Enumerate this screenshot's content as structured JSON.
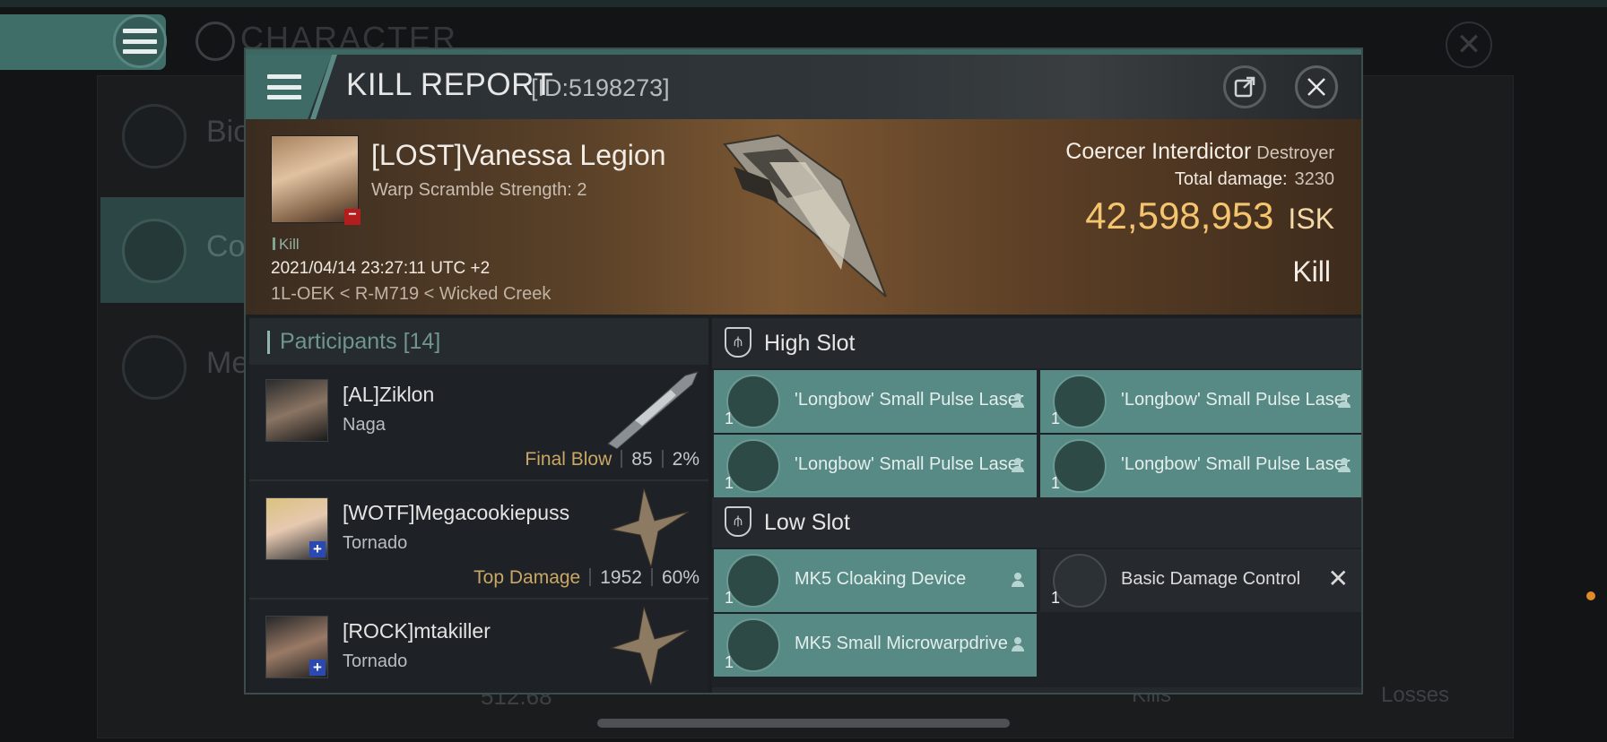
{
  "background": {
    "title": "CHARACTER",
    "side_items": [
      {
        "label": "Bio"
      },
      {
        "label": "Con"
      },
      {
        "label": "Me"
      }
    ],
    "bottom_value": "512.68",
    "kills_label": "Kills",
    "losses_label": "Losses"
  },
  "modal": {
    "title": "KILL REPORT",
    "report_id": "[ID:5198273]"
  },
  "victim": {
    "name": "[LOST]Vanessa Legion",
    "warp_scramble": "Warp Scramble Strength: 2",
    "kill_tag": "Kill",
    "timestamp": "2021/04/14 23:27:11 UTC +2",
    "location": "1L-OEK < R-M719 < Wicked Creek",
    "ship_name": "Coercer Interdictor",
    "ship_class": "Destroyer",
    "total_damage_label": "Total damage:",
    "total_damage": "3230",
    "isk_value": "42,598,953",
    "isk_unit": "ISK",
    "result": "Kill"
  },
  "participants": {
    "label": "Participants",
    "count": "[14]",
    "rows": [
      {
        "name": "[AL]Ziklon",
        "ship": "Naga",
        "role": "Final Blow",
        "damage": "85",
        "percent": "2%"
      },
      {
        "name": "[WOTF]Megacookiepuss",
        "ship": "Tornado",
        "role": "Top Damage",
        "damage": "1952",
        "percent": "60%"
      },
      {
        "name": "[ROCK]mtakiller",
        "ship": "Tornado",
        "role": "",
        "damage": "",
        "percent": ""
      }
    ]
  },
  "fitting": {
    "high_slot": {
      "title": "High Slot",
      "modules": [
        {
          "name": "'Longbow' Small Pulse Laser",
          "qty": "1"
        },
        {
          "name": "'Longbow' Small Pulse Laser",
          "qty": "1"
        },
        {
          "name": "'Longbow' Small Pulse Laser",
          "qty": "1"
        },
        {
          "name": "'Longbow' Small Pulse Laser",
          "qty": "1"
        }
      ]
    },
    "low_slot": {
      "title": "Low Slot",
      "modules": [
        {
          "name": "MK5 Cloaking Device",
          "qty": "1",
          "status": "dropped"
        },
        {
          "name": "Basic Damage Control",
          "qty": "1",
          "status": "destroyed"
        },
        {
          "name": "MK5 Small Microwarpdrive",
          "qty": "1",
          "status": "dropped"
        }
      ]
    }
  },
  "icons": {
    "menu": "hamburger-icon",
    "share": "external-link-icon",
    "close": "close-icon",
    "slot": "slot-shield-icon",
    "person": "person-icon"
  },
  "colors": {
    "accent": "#578a84",
    "isk": "#f4c46f",
    "role_label": "#caa764"
  }
}
